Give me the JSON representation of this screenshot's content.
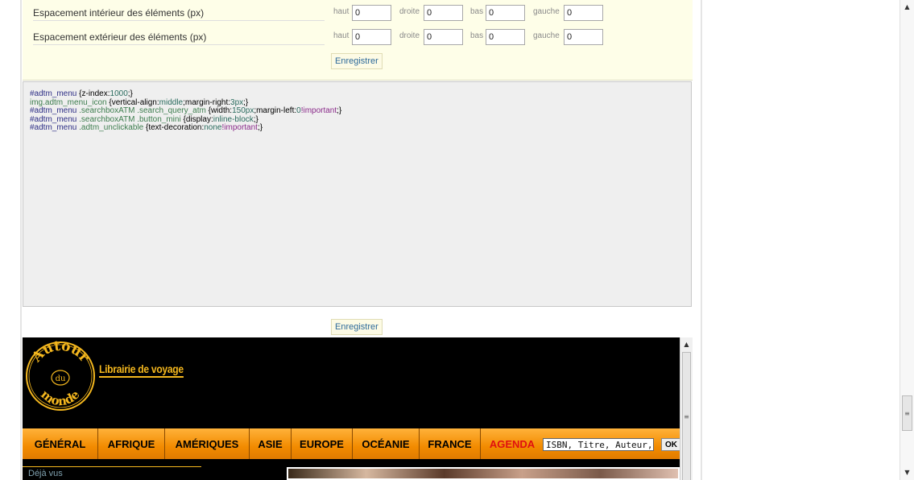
{
  "config": {
    "rows": [
      {
        "label": "Espacement intérieur des éléments (px)",
        "haut": "0",
        "droite": "0",
        "bas": "0",
        "gauche": "0"
      },
      {
        "label": "Espacement extérieur des éléments (px)",
        "haut": "0",
        "droite": "0",
        "bas": "0",
        "gauche": "0"
      }
    ],
    "field_labels": {
      "haut": "haut",
      "droite": "droite",
      "bas": "bas",
      "gauche": "gauche"
    },
    "save_label": "Enregistrer"
  },
  "css_editor": {
    "line1": {
      "sel": "#adtm_menu",
      "rest": " {z-index:",
      "val": "1000",
      "end": ";}"
    },
    "line2": {
      "sel": "img.adtm_menu_icon",
      "rest": " {vertical-align:",
      "val": "middle",
      "rest2": ";margin-right:",
      "val2": "3px",
      "end": ";}"
    },
    "line3": {
      "sel": "#adtm_menu",
      "cls": " .searchboxATM .search_query_atm",
      "rest": " {width:",
      "val": "150px",
      "rest2": ";margin-left:",
      "val2": "0",
      "imp": "!important",
      "end": ";}"
    },
    "line4": {
      "sel": "#adtm_menu",
      "cls": " .searchboxATM .button_mini",
      "rest": " {display:",
      "val": "inline-block",
      "end": ";}"
    },
    "line5": {
      "sel": "#adtm_menu",
      "cls": " .adtm_unclickable",
      "rest": " {text-decoration:",
      "val": "none",
      "imp": "!important",
      "end": ";}"
    }
  },
  "save_label_bottom": "Enregistrer",
  "preview": {
    "logo": {
      "top_text": "Autour",
      "middle_text": "du",
      "bottom_text": "monde",
      "tagline": "Librairie de voyage"
    },
    "menu": [
      {
        "label": "GÉNÉRAL"
      },
      {
        "label": "AFRIQUE"
      },
      {
        "label": "AMÉRIQUES"
      },
      {
        "label": "ASIE"
      },
      {
        "label": "EUROPE"
      },
      {
        "label": "OCÉANIE"
      },
      {
        "label": "FRANCE"
      },
      {
        "label": "AGENDA"
      }
    ],
    "search_placeholder": "ISBN, Titre, Auteur,...",
    "ok_label": "OK",
    "deja_vus": "Déjà vus"
  },
  "colors": {
    "accent_orange": "#f28b00",
    "logo_gold": "#f4b71e",
    "link_blue": "#2d6a9a",
    "agenda_red": "#e01010"
  }
}
